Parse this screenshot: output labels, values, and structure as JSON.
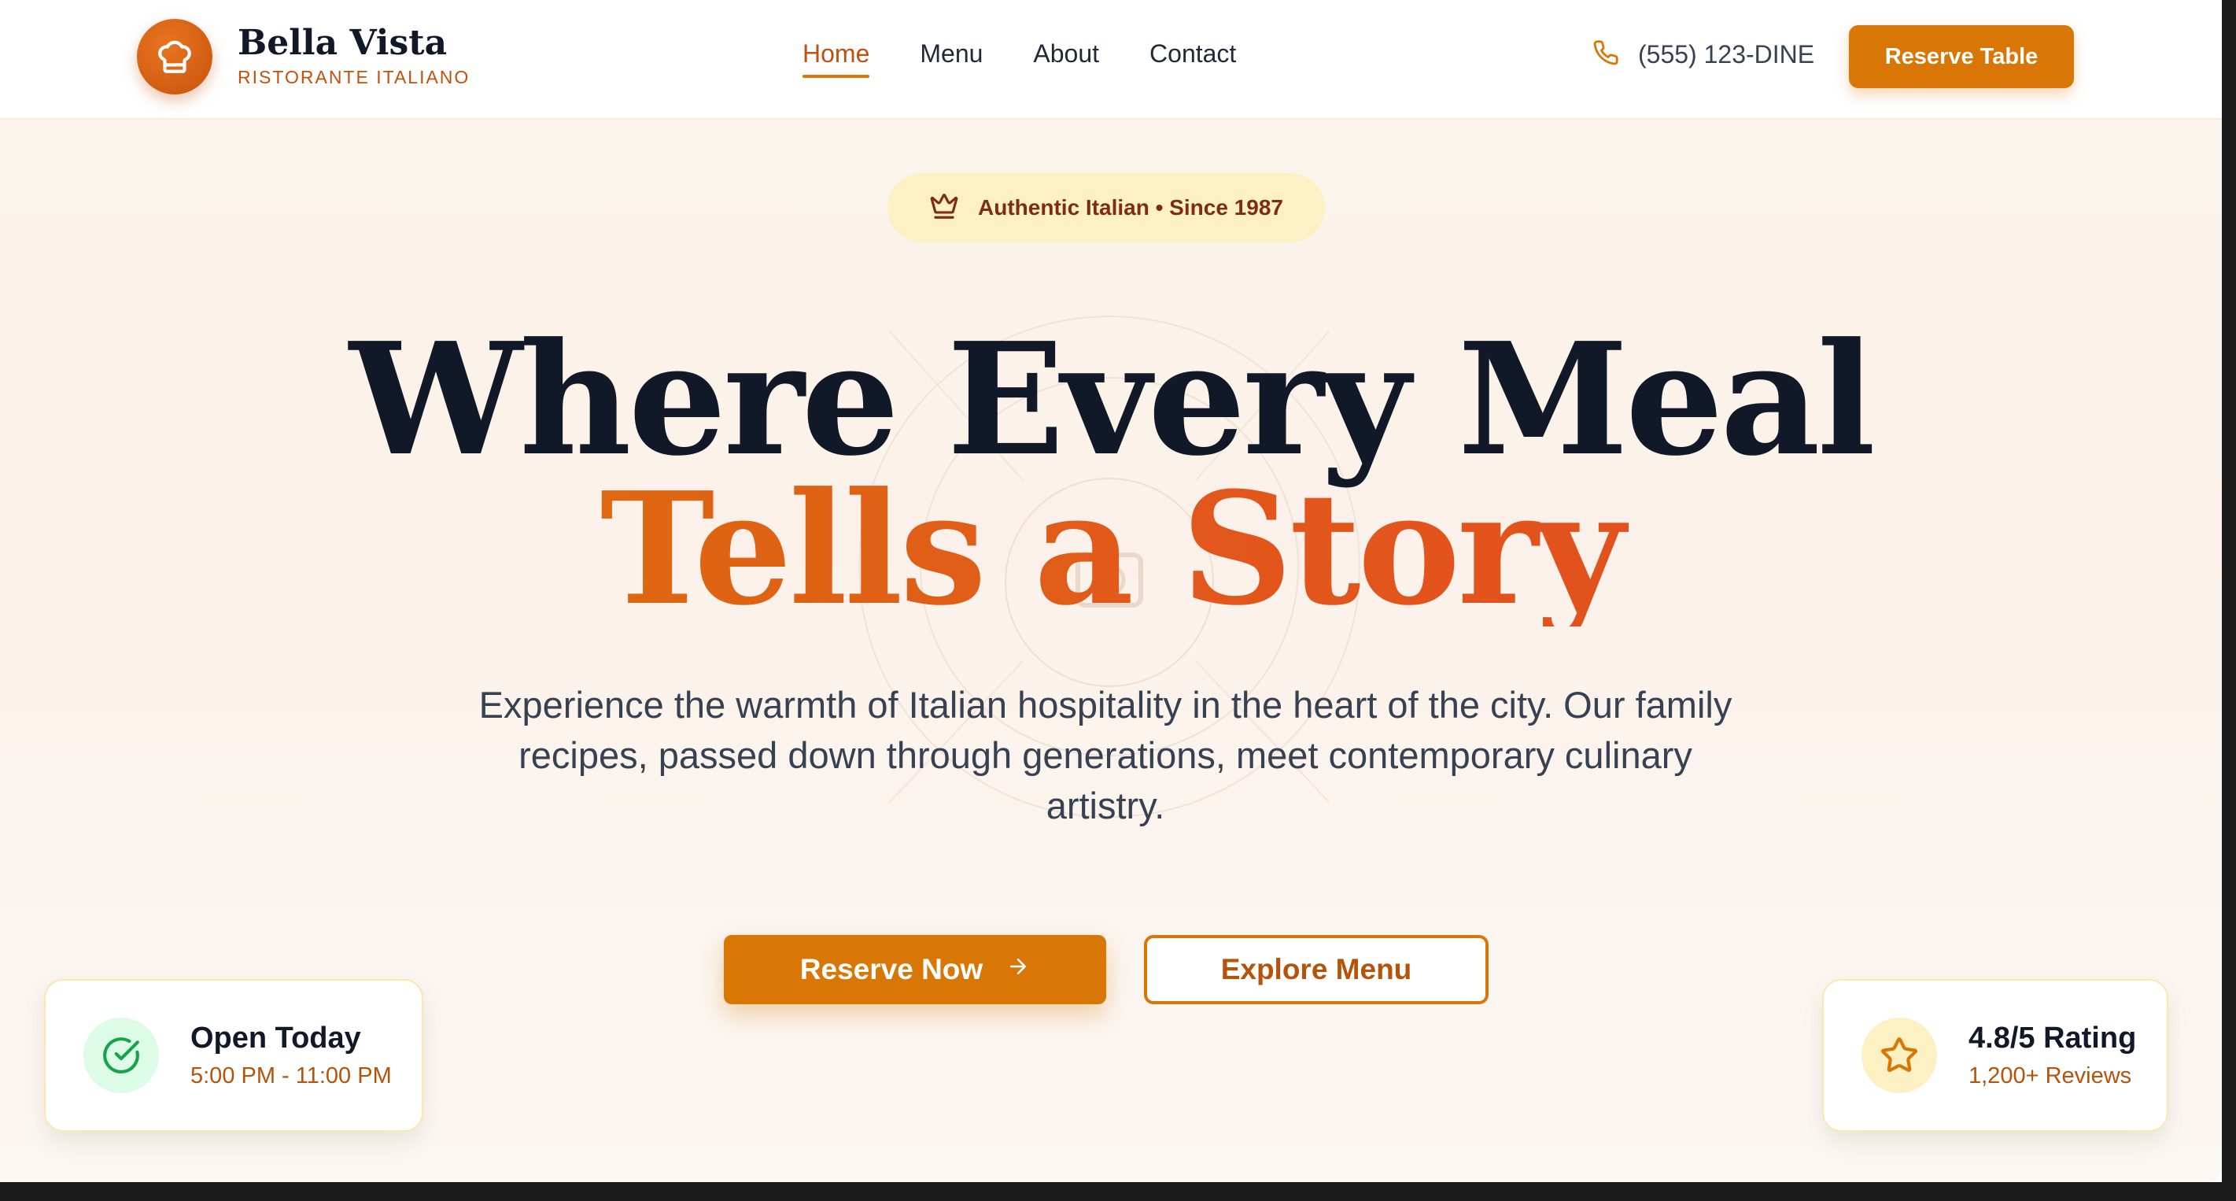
{
  "header": {
    "brand_name": "Bella Vista",
    "brand_tagline": "RISTORANTE ITALIANO",
    "logo_icon": "chef-hat-icon",
    "nav": [
      {
        "label": "Home",
        "active": true
      },
      {
        "label": "Menu",
        "active": false
      },
      {
        "label": "About",
        "active": false
      },
      {
        "label": "Contact",
        "active": false
      }
    ],
    "phone": "(555) 123-DINE",
    "reserve_label": "Reserve Table"
  },
  "hero": {
    "badge": "Authentic Italian • Since 1987",
    "badge_icon": "crown-icon",
    "headline_line1": "Where Every Meal",
    "headline_line2": "Tells a Story",
    "lead": "Experience the warmth of Italian hospitality in the heart of the city. Our family recipes, passed down through generations, meet contemporary culinary artistry.",
    "primary_cta": "Reserve Now",
    "secondary_cta": "Explore Menu"
  },
  "hours_card": {
    "title": "Open Today",
    "subtitle": "5:00 PM - 11:00 PM",
    "icon": "check-circle-icon"
  },
  "rating_card": {
    "title": "4.8/5 Rating",
    "subtitle": "1,200+ Reviews",
    "icon": "star-icon"
  },
  "colors": {
    "accent": "#d97706",
    "accent_dark": "#c2500d",
    "headline": "#111827",
    "headline_gradient_end": "#e24a1e"
  }
}
